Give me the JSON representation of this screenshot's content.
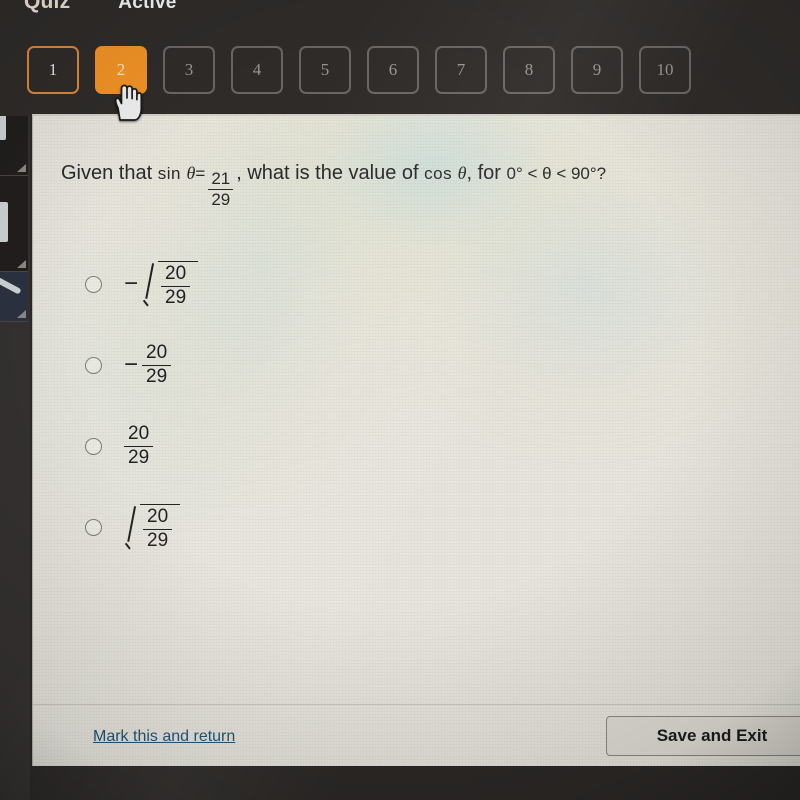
{
  "header": {
    "quiz_label": "Quiz",
    "status_label": "Active"
  },
  "question_nav": {
    "buttons": [
      {
        "label": "1",
        "state": "answered"
      },
      {
        "label": "2",
        "state": "current"
      },
      {
        "label": "3",
        "state": "unvisited"
      },
      {
        "label": "4",
        "state": "unvisited"
      },
      {
        "label": "5",
        "state": "unvisited"
      },
      {
        "label": "6",
        "state": "unvisited"
      },
      {
        "label": "7",
        "state": "unvisited"
      },
      {
        "label": "8",
        "state": "unvisited"
      },
      {
        "label": "9",
        "state": "unvisited"
      },
      {
        "label": "10",
        "state": "unvisited"
      }
    ]
  },
  "question": {
    "lead": "Given that",
    "fn_sin": "sin",
    "theta": "θ",
    "equals": "=",
    "sin_value_num": "21",
    "sin_value_den": "29",
    "middle": ", what is the value of",
    "fn_cos": "cos",
    "theta2": "θ",
    "comma_for": ", for",
    "range": "0° < θ < 90°?"
  },
  "options": [
    {
      "id": "option-a",
      "sign": "−",
      "has_radical": true,
      "numerator": "20",
      "denominator": "29",
      "selected": false
    },
    {
      "id": "option-b",
      "sign": "−",
      "has_radical": false,
      "numerator": "20",
      "denominator": "29",
      "selected": false
    },
    {
      "id": "option-c",
      "sign": "",
      "has_radical": false,
      "numerator": "20",
      "denominator": "29",
      "selected": false
    },
    {
      "id": "option-d",
      "sign": "",
      "has_radical": true,
      "numerator": "20",
      "denominator": "29",
      "selected": false
    }
  ],
  "footer": {
    "mark_link": "Mark this and return",
    "save_exit_button": "Save and Exit"
  },
  "colors": {
    "accent_orange": "#ef9126",
    "answered_border": "#d8863a",
    "panel_background": "#e7e5dd",
    "topbar_background": "#2e2b29",
    "link_blue": "#1d4f6e"
  }
}
